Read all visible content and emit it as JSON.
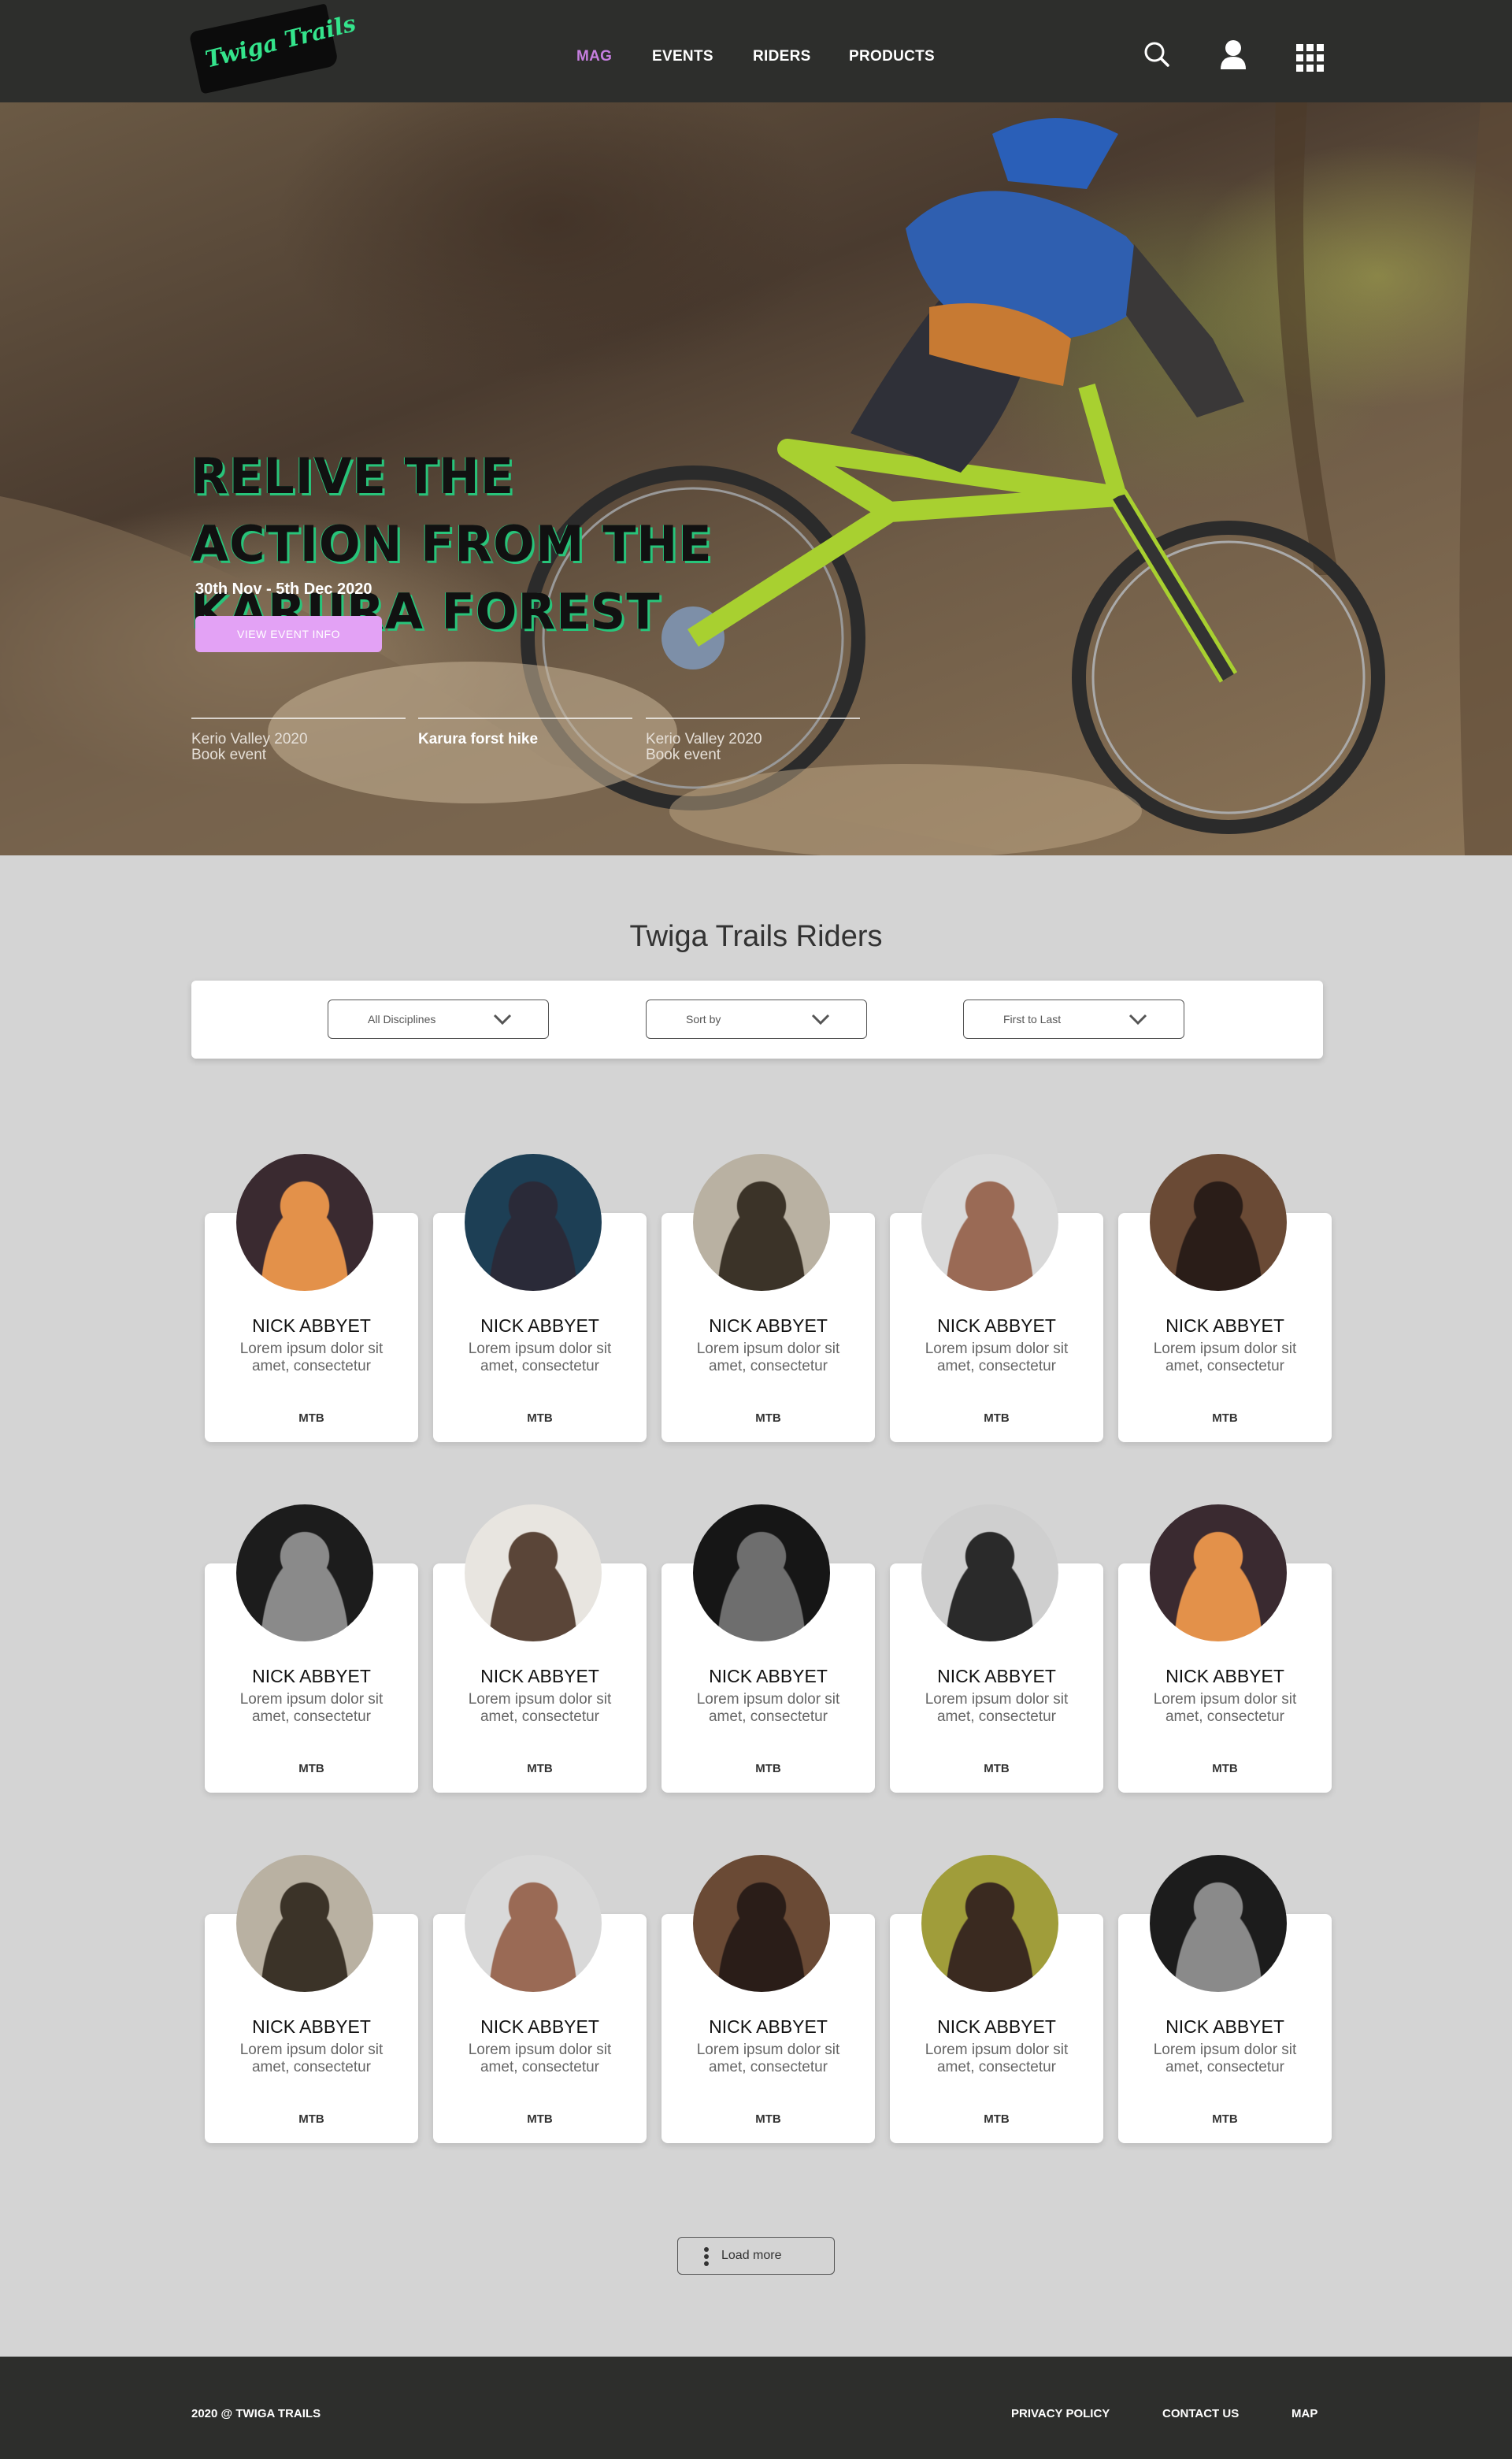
{
  "brand": {
    "logo_text": "Twiga Trails"
  },
  "nav": {
    "items": [
      "MAG",
      "EVENTS",
      "RIDERS",
      "PRODUCTS"
    ],
    "active": "MAG"
  },
  "icons": {
    "search": "search-icon",
    "user": "user-icon",
    "apps": "grid-icon"
  },
  "hero": {
    "title_lines": [
      "RELIVE THE",
      "ACTION FROM THE",
      "KARURA FOREST"
    ],
    "date": "30th Nov  - 5th Dec 2020",
    "button": "VIEW EVENT INFO",
    "events": [
      {
        "title": "Kerio Valley 2020",
        "sub": "Book event"
      },
      {
        "title": "Karura forst hike",
        "sub": ""
      },
      {
        "title": "Kerio Valley 2020",
        "sub": "Book event"
      }
    ]
  },
  "riders_section": {
    "title": "Twiga Trails Riders",
    "filters": [
      "All Disciplines",
      "Sort by",
      "First to Last"
    ]
  },
  "riders": [
    {
      "name": "NICK ABBYET",
      "desc": "Lorem ipsum dolor sit amet, consectetur",
      "tag": "MTB"
    },
    {
      "name": "NICK ABBYET",
      "desc": "Lorem ipsum dolor sit amet, consectetur",
      "tag": "MTB"
    },
    {
      "name": "NICK ABBYET",
      "desc": "Lorem ipsum dolor sit amet, consectetur",
      "tag": "MTB"
    },
    {
      "name": "NICK ABBYET",
      "desc": "Lorem ipsum dolor sit amet, consectetur",
      "tag": "MTB"
    },
    {
      "name": "NICK ABBYET",
      "desc": "Lorem ipsum dolor sit amet, consectetur",
      "tag": "MTB"
    },
    {
      "name": "NICK ABBYET",
      "desc": "Lorem ipsum dolor sit amet, consectetur",
      "tag": "MTB"
    },
    {
      "name": "NICK ABBYET",
      "desc": "Lorem ipsum dolor sit amet, consectetur",
      "tag": "MTB"
    },
    {
      "name": "NICK ABBYET",
      "desc": "Lorem ipsum dolor sit amet, consectetur",
      "tag": "MTB"
    },
    {
      "name": "NICK ABBYET",
      "desc": "Lorem ipsum dolor sit amet, consectetur",
      "tag": "MTB"
    },
    {
      "name": "NICK ABBYET",
      "desc": "Lorem ipsum dolor sit amet, consectetur",
      "tag": "MTB"
    },
    {
      "name": "NICK ABBYET",
      "desc": "Lorem ipsum dolor sit amet, consectetur",
      "tag": "MTB"
    },
    {
      "name": "NICK ABBYET",
      "desc": "Lorem ipsum dolor sit amet, consectetur",
      "tag": "MTB"
    },
    {
      "name": "NICK ABBYET",
      "desc": "Lorem ipsum dolor sit amet, consectetur",
      "tag": "MTB"
    },
    {
      "name": "NICK ABBYET",
      "desc": "Lorem ipsum dolor sit amet, consectetur",
      "tag": "MTB"
    },
    {
      "name": "NICK ABBYET",
      "desc": "Lorem ipsum dolor sit amet, consectetur",
      "tag": "MTB"
    }
  ],
  "load_more": "Load more",
  "footer": {
    "copyright": "2020 @ TWIGA TRAILS",
    "links": [
      "PRIVACY POLICY",
      "CONTACT US",
      "MAP"
    ]
  },
  "colors": {
    "nav_bg": "#2d2e2c",
    "accent": "#c77fe0",
    "button": "#e3a2f5",
    "logo_green": "#34e48c",
    "page_bg": "#d4d4d4"
  }
}
